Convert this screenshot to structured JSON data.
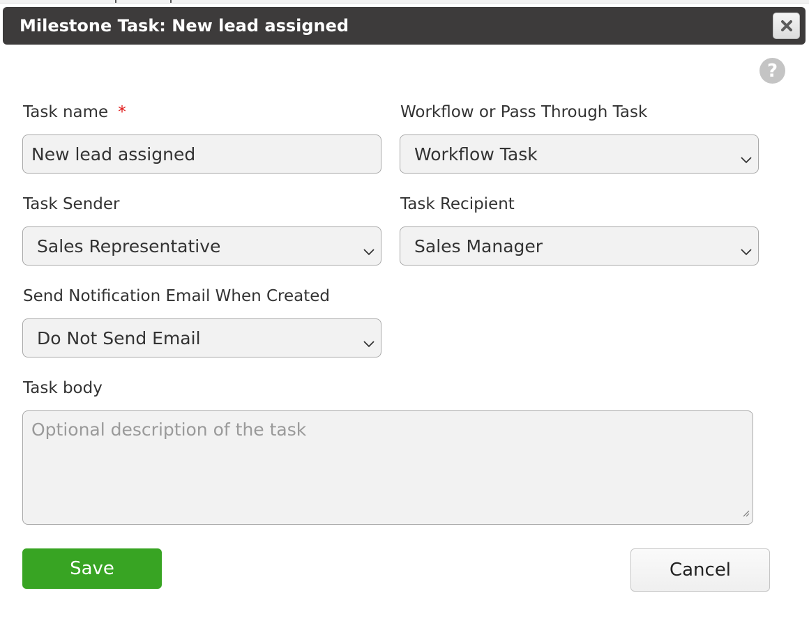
{
  "dialog": {
    "title": "Milestone Task: New lead assigned",
    "help_glyph": "?",
    "icons": {
      "close": "close-icon",
      "help": "help-icon",
      "dropdown": "chevron-down-icon",
      "resize": "resize-handle-icon"
    }
  },
  "form": {
    "task_name": {
      "label": "Task name",
      "required_mark": "*",
      "value": "New lead assigned"
    },
    "task_type": {
      "label": "Workflow or Pass Through Task",
      "selected": "Workflow Task"
    },
    "task_sender": {
      "label": "Task Sender",
      "selected": "Sales Representative"
    },
    "task_recipient": {
      "label": "Task Recipient",
      "selected": "Sales Manager"
    },
    "notification_email": {
      "label": "Send Notification Email When Created",
      "selected": "Do Not Send Email"
    },
    "task_body": {
      "label": "Task body",
      "placeholder": "Optional description of the task",
      "value": ""
    }
  },
  "actions": {
    "save_label": "Save",
    "cancel_label": "Cancel"
  },
  "colors": {
    "titlebar": "#3d3b3b",
    "save_button": "#38a423",
    "required_star": "#e01919",
    "field_background": "#f2f2f2"
  }
}
